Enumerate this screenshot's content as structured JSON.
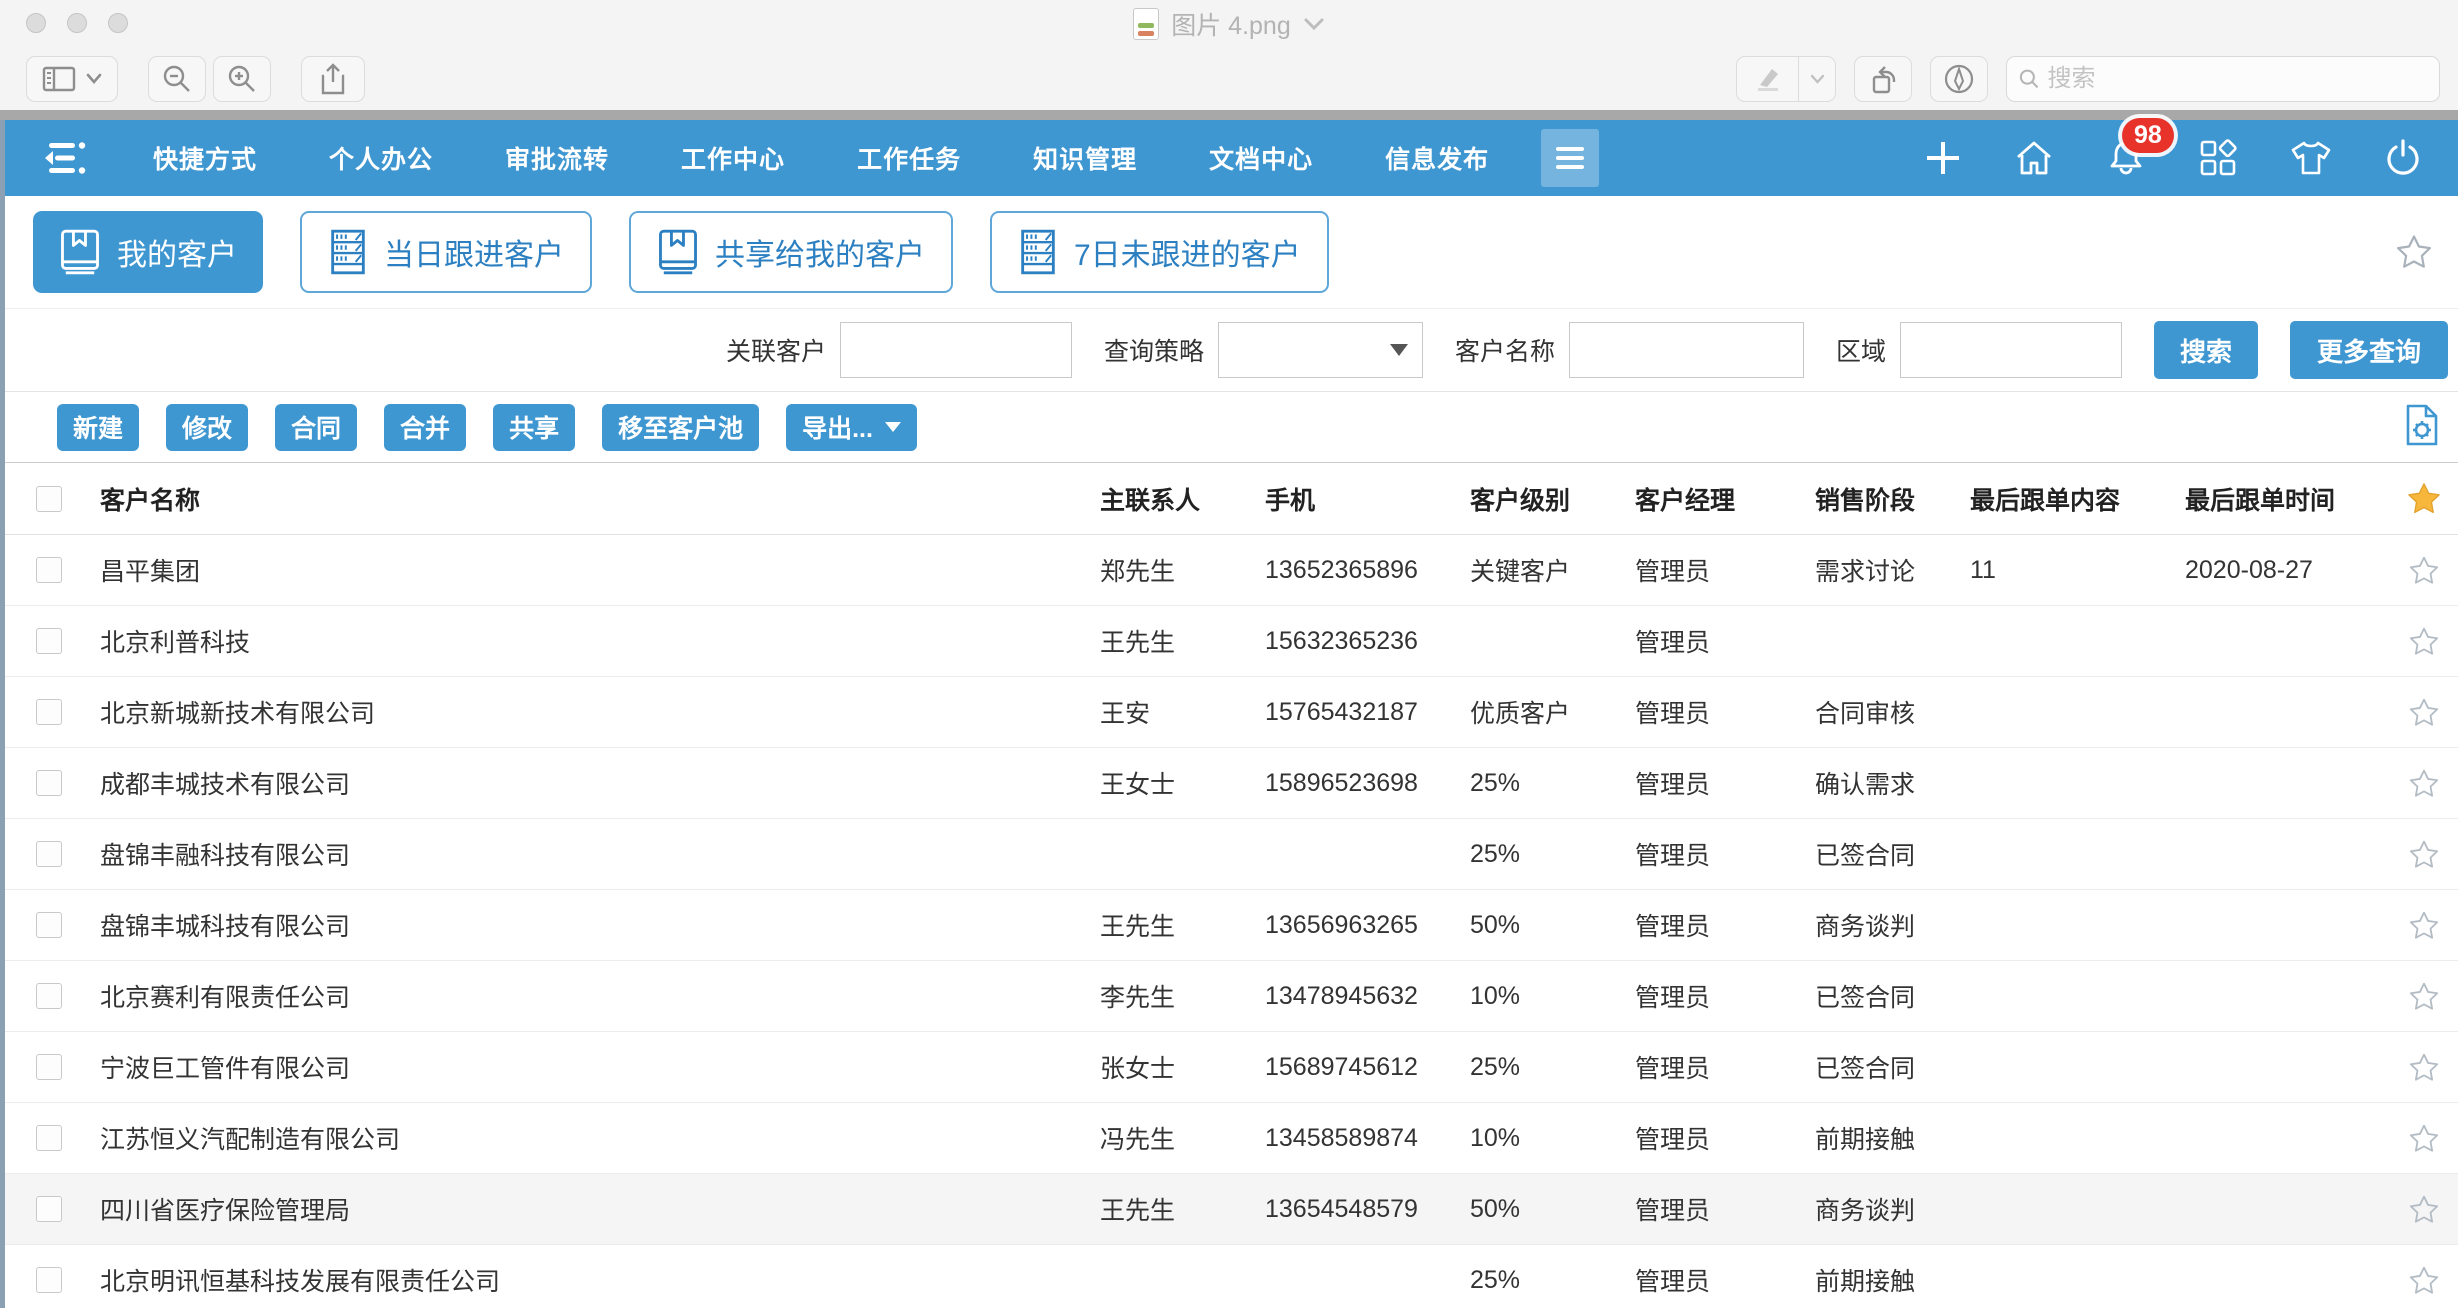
{
  "window": {
    "title": "图片 4.png",
    "toolbar": {
      "search_placeholder": "搜索"
    }
  },
  "nav": {
    "menu_items": [
      "快捷方式",
      "个人办公",
      "审批流转",
      "工作中心",
      "工作任务",
      "知识管理",
      "文档中心",
      "信息发布"
    ],
    "notification_badge": "98"
  },
  "tabs": [
    {
      "label": "我的客户",
      "icon": "book",
      "active": true
    },
    {
      "label": "当日跟进客户",
      "icon": "shelf",
      "active": false
    },
    {
      "label": "共享给我的客户",
      "icon": "book",
      "active": false
    },
    {
      "label": "7日未跟进的客户",
      "icon": "shelf",
      "active": false
    }
  ],
  "filters": {
    "related_customer_label": "关联客户",
    "related_customer_value": "",
    "query_strategy_label": "查询策略",
    "query_strategy_value": "",
    "customer_name_label": "客户名称",
    "customer_name_value": "",
    "region_label": "区域",
    "region_value": "",
    "search_button": "搜索",
    "more_query_button": "更多查询"
  },
  "actions": [
    "新建",
    "修改",
    "合同",
    "合并",
    "共享",
    "移至客户池",
    "导出..."
  ],
  "table": {
    "headers": [
      "客户名称",
      "主联系人",
      "手机",
      "客户级别",
      "客户经理",
      "销售阶段",
      "最后跟单内容",
      "最后跟单时间"
    ],
    "rows": [
      {
        "name": "昌平集团",
        "contact": "郑先生",
        "phone": "13652365896",
        "level": "关键客户",
        "manager": "管理员",
        "stage": "需求讨论",
        "last_content": "11",
        "last_time": "2020-08-27",
        "highlight": false
      },
      {
        "name": "北京利普科技",
        "contact": "王先生",
        "phone": "15632365236",
        "level": "",
        "manager": "管理员",
        "stage": "",
        "last_content": "",
        "last_time": "",
        "highlight": false
      },
      {
        "name": "北京新城新技术有限公司",
        "contact": "王安",
        "phone": "15765432187",
        "level": "优质客户",
        "manager": "管理员",
        "stage": "合同审核",
        "last_content": "",
        "last_time": "",
        "highlight": false
      },
      {
        "name": "成都丰城技术有限公司",
        "contact": "王女士",
        "phone": "15896523698",
        "level": "25%",
        "manager": "管理员",
        "stage": "确认需求",
        "last_content": "",
        "last_time": "",
        "highlight": false
      },
      {
        "name": "盘锦丰融科技有限公司",
        "contact": "",
        "phone": "",
        "level": "25%",
        "manager": "管理员",
        "stage": "已签合同",
        "last_content": "",
        "last_time": "",
        "highlight": false
      },
      {
        "name": "盘锦丰城科技有限公司",
        "contact": "王先生",
        "phone": "13656963265",
        "level": "50%",
        "manager": "管理员",
        "stage": "商务谈判",
        "last_content": "",
        "last_time": "",
        "highlight": false
      },
      {
        "name": "北京赛利有限责任公司",
        "contact": "李先生",
        "phone": "13478945632",
        "level": "10%",
        "manager": "管理员",
        "stage": "已签合同",
        "last_content": "",
        "last_time": "",
        "highlight": false
      },
      {
        "name": "宁波巨工管件有限公司",
        "contact": "张女士",
        "phone": "15689745612",
        "level": "25%",
        "manager": "管理员",
        "stage": "已签合同",
        "last_content": "",
        "last_time": "",
        "highlight": false
      },
      {
        "name": "江苏恒义汽配制造有限公司",
        "contact": "冯先生",
        "phone": "13458589874",
        "level": "10%",
        "manager": "管理员",
        "stage": "前期接触",
        "last_content": "",
        "last_time": "",
        "highlight": false
      },
      {
        "name": "四川省医疗保险管理局",
        "contact": "王先生",
        "phone": "13654548579",
        "level": "50%",
        "manager": "管理员",
        "stage": "商务谈判",
        "last_content": "",
        "last_time": "",
        "highlight": true
      },
      {
        "name": "北京明讯恒基科技发展有限责任公司",
        "contact": "",
        "phone": "",
        "level": "25%",
        "manager": "管理员",
        "stage": "前期接触",
        "last_content": "",
        "last_time": "",
        "highlight": false
      }
    ]
  },
  "icons": {
    "menu-collapse-icon": "hamburger with left arrow",
    "hamburger-icon": "three bars",
    "plus-icon": "+",
    "home-icon": "house outline",
    "bell-icon": "notification bell",
    "apps-grid-icon": "three squares + diamond",
    "theme-shirt-icon": "t-shirt outline",
    "power-icon": "power symbol",
    "book-icon": "book with bookmark",
    "shelf-icon": "bookshelf",
    "star-icon": "star",
    "column-settings-icon": "document with gear",
    "search-icon": "magnifier"
  },
  "colors": {
    "accent_blue": "#3F97D2",
    "badge_red": "#E8332A",
    "star_gold": "#F6B73C"
  }
}
